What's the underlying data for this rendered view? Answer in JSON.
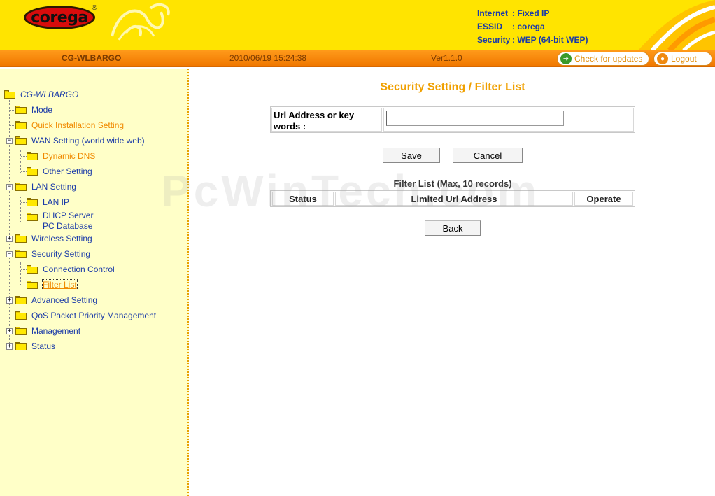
{
  "header": {
    "logo_text": "corega",
    "logo_mark": "®",
    "status": [
      {
        "key": "Internet",
        "value": ": Fixed IP"
      },
      {
        "key": "ESSID",
        "value": ": corega"
      },
      {
        "key": "Security",
        "value": ": WEP (64-bit WEP)"
      }
    ]
  },
  "topbar": {
    "model": "CG-WLBARGO",
    "datetime": "2010/06/19 15:24:38",
    "version": "Ver1.1.0",
    "check_updates_label": "Check for updates",
    "logout_label": "Logout"
  },
  "sidebar": {
    "root": "CG-WLBARGO",
    "items": {
      "mode": "Mode",
      "quick_install": "Quick Installation Setting",
      "wan": "WAN Setting (world wide web)",
      "dynamic_dns": "Dynamic DNS",
      "other_setting": "Other Setting",
      "lan": "LAN Setting",
      "lan_ip": "LAN IP",
      "dhcp_server": "DHCP Server",
      "pc_database": "PC Database",
      "wireless": "Wireless Setting",
      "security": "Security Setting",
      "connection_control": "Connection Control",
      "filter_list": "Filter List",
      "advanced": "Advanced Setting",
      "qos": "QoS Packet Priority Management",
      "management": "Management",
      "status": "Status"
    }
  },
  "main": {
    "title": "Security Setting / Filter List",
    "url_label": "Url Address or key words :",
    "url_value": "",
    "save_label": "Save",
    "cancel_label": "Cancel",
    "list_caption": "Filter List (Max, 10 records)",
    "columns": [
      "Status",
      "Limited Url Address",
      "Operate"
    ],
    "back_label": "Back"
  },
  "watermark": "PcWinTech.com",
  "colors": {
    "header_yellow": "#ffe400",
    "bar_orange": "#f07800",
    "sidebar_bg": "#ffffc8",
    "title_orange": "#f0a000",
    "link_blue": "#1a3aa8"
  }
}
